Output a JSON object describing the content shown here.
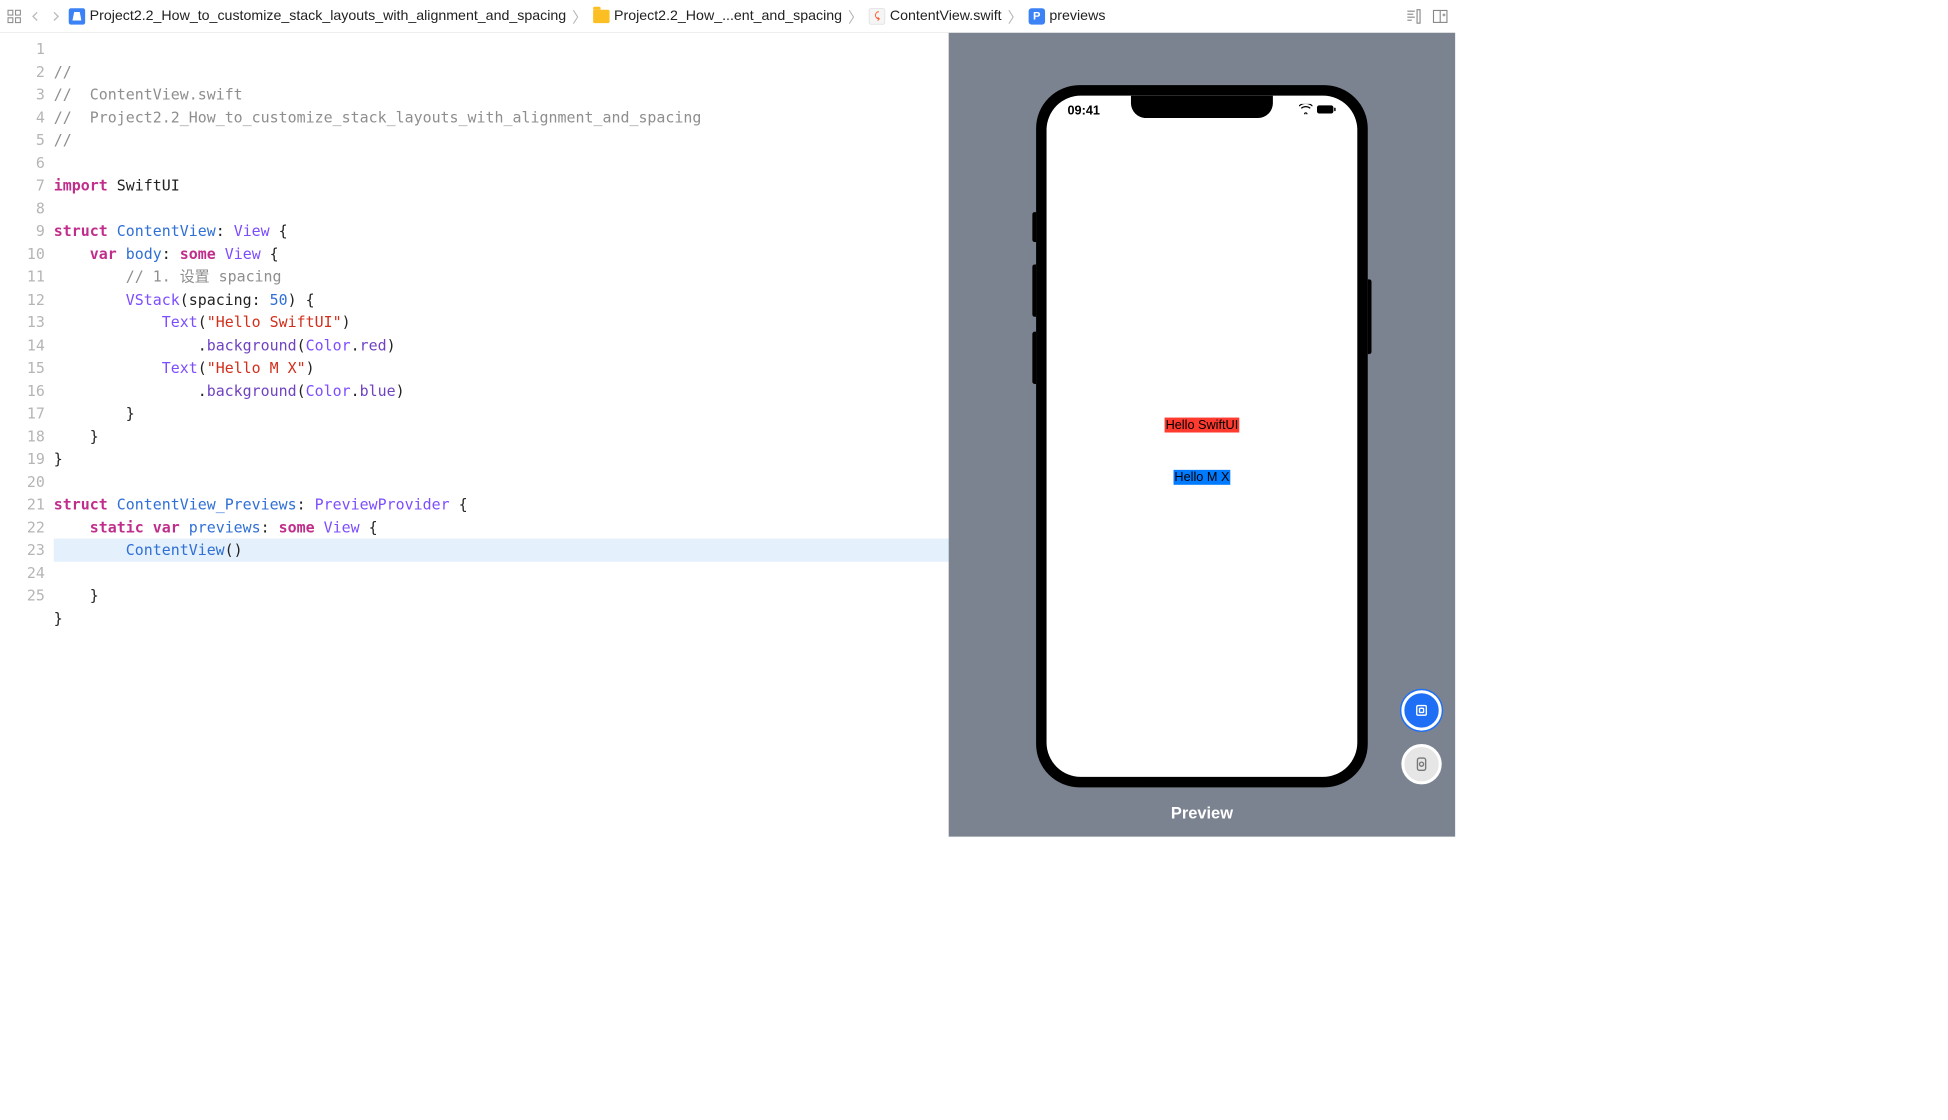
{
  "breadcrumb": {
    "item1": "Project2.2_How_to_customize_stack_layouts_with_alignment_and_spacing",
    "item2": "Project2.2_How_...ent_and_spacing",
    "item3": "ContentView.swift",
    "item4_icon": "P",
    "item4": "previews"
  },
  "code": {
    "lines": {
      "l1": "//",
      "l2_a": "//  ",
      "l2_b": "ContentView.swift",
      "l3_a": "//  ",
      "l3_b": "Project2.2_How_to_customize_stack_layouts_with_alignment_and_spacing",
      "l4": "//",
      "l5": "",
      "l6_import": "import",
      "l6_mod": " SwiftUI",
      "l7": "",
      "l8_struct": "struct ",
      "l8_name": "ContentView",
      "l8_colon": ": ",
      "l8_proto": "View",
      "l8_brace": " {",
      "l9_var": "    var ",
      "l9_body": "body",
      "l9_colon": ": ",
      "l9_some": "some ",
      "l9_view": "View",
      "l9_brace": " {",
      "l10_a": "        ",
      "l10_b": "// 1. 设置 spacing",
      "l11_pad": "        ",
      "l11_vstack": "VStack",
      "l11_args_open": "(spacing: ",
      "l11_num": "50",
      "l11_args_close": ") {",
      "l12_pad": "            ",
      "l12_text": "Text",
      "l12_open": "(",
      "l12_str": "\"Hello SwiftUI\"",
      "l12_close": ")",
      "l13_pad": "                .",
      "l13_bg": "background",
      "l13_args": "(",
      "l13_color": "Color",
      "l13_dot": ".",
      "l13_red": "red",
      "l13_close": ")",
      "l14_pad": "            ",
      "l14_text": "Text",
      "l14_open": "(",
      "l14_str": "\"Hello M X\"",
      "l14_close": ")",
      "l15_pad": "                .",
      "l15_bg": "background",
      "l15_args": "(",
      "l15_color": "Color",
      "l15_dot": ".",
      "l15_blue": "blue",
      "l15_close": ")",
      "l16": "        }",
      "l17": "    }",
      "l18": "}",
      "l19": "",
      "l20_struct": "struct ",
      "l20_name": "ContentView_Previews",
      "l20_colon": ": ",
      "l20_proto": "PreviewProvider",
      "l20_brace": " {",
      "l21_static": "    static ",
      "l21_var": "var ",
      "l21_prev": "previews",
      "l21_colon": ": ",
      "l21_some": "some ",
      "l21_view": "View",
      "l21_brace": " {",
      "l22_pad": "        ",
      "l22_cv": "ContentView",
      "l22_paren": "()",
      "l23": "    }",
      "l24": "}",
      "l25": ""
    },
    "linenums": [
      "1",
      "2",
      "3",
      "4",
      "5",
      "6",
      "7",
      "8",
      "9",
      "10",
      "11",
      "12",
      "13",
      "14",
      "15",
      "16",
      "17",
      "18",
      "19",
      "20",
      "21",
      "22",
      "23",
      "24",
      "25"
    ],
    "highlighted_line": 22
  },
  "preview": {
    "time": "09:41",
    "text1": "Hello SwiftUI",
    "text2": "Hello M X",
    "label": "Preview"
  }
}
